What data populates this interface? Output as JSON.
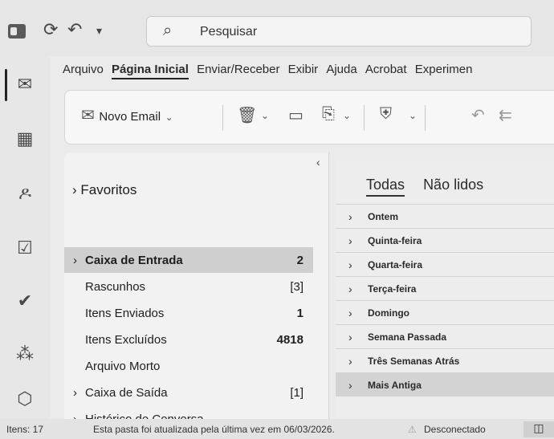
{
  "search": {
    "placeholder": "Pesquisar"
  },
  "ribbon_tabs": [
    "Arquivo",
    "Página Inicial",
    "Enviar/Receber",
    "Exibir",
    "Ajuda",
    "Acrobat",
    "Experimen"
  ],
  "toolbar": {
    "new_email_label": "Novo Email"
  },
  "folders": {
    "favorites_label": "Favoritos",
    "items": [
      {
        "label": "Caixa de Entrada",
        "count": "2"
      },
      {
        "label": "Rascunhos",
        "count": "[3]"
      },
      {
        "label": "Itens Enviados",
        "count": "1"
      },
      {
        "label": "Itens Excluídos",
        "count": "4818"
      },
      {
        "label": "Arquivo Morto",
        "count": ""
      },
      {
        "label": "Caixa de Saída",
        "count": "[1]"
      },
      {
        "label": "Histórico de Conversa",
        "count": ""
      }
    ]
  },
  "message_list": {
    "tabs": [
      "Todas",
      "Não lidos"
    ],
    "groups": [
      "Ontem",
      "Quinta-feira",
      "Quarta-feira",
      "Terça-feira",
      "Domingo",
      "Semana Passada",
      "Três Semanas Atrás",
      "Mais Antiga"
    ]
  },
  "status": {
    "items": "Itens: 17",
    "updated": "Esta pasta foi atualizada pela última vez em 06/03/2026.",
    "connection": "Desconectado"
  },
  "icons": [
    "outlook-app-icon",
    "sync-icon",
    "undo-icon",
    "dropdown-icon",
    "search-icon",
    "mail-icon",
    "calendar-icon",
    "people-icon",
    "tasks-icon",
    "todo-check-icon",
    "org-icon",
    "apps-icon",
    "new-mail-icon",
    "delete-icon",
    "archive-icon",
    "move-icon",
    "shield-icon",
    "reply-icon",
    "reply-all-icon",
    "warning-icon",
    "view-icon"
  ]
}
